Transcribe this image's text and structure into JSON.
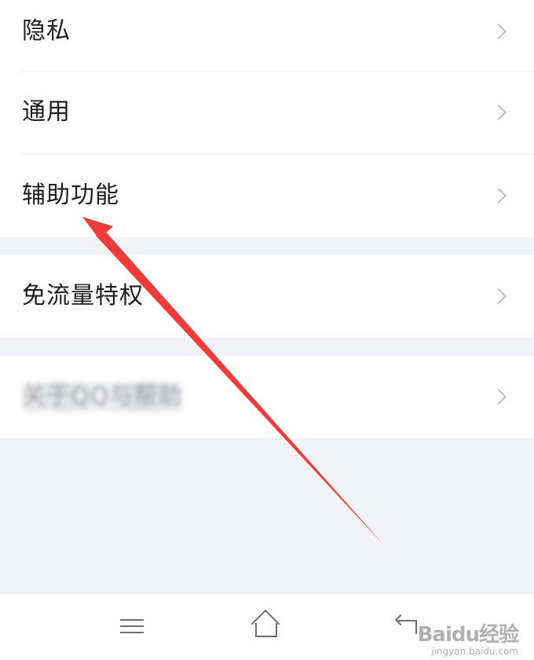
{
  "menu_groups": [
    {
      "items": [
        {
          "label": "隐私"
        },
        {
          "label": "通用"
        },
        {
          "label": "辅助功能"
        }
      ]
    },
    {
      "items": [
        {
          "label": "免流量特权"
        }
      ]
    },
    {
      "items": [
        {
          "label": "关于QQ与帮助",
          "blurred": true
        }
      ]
    }
  ],
  "annotation": {
    "type": "arrow",
    "color": "#ef3b3b",
    "points_to": "辅助功能"
  },
  "bottom_nav": {
    "items": [
      "menu-icon",
      "home-icon",
      "back-icon"
    ]
  },
  "watermark": {
    "main": "Baidu经验",
    "sub": "jingyan.baidu.com"
  }
}
